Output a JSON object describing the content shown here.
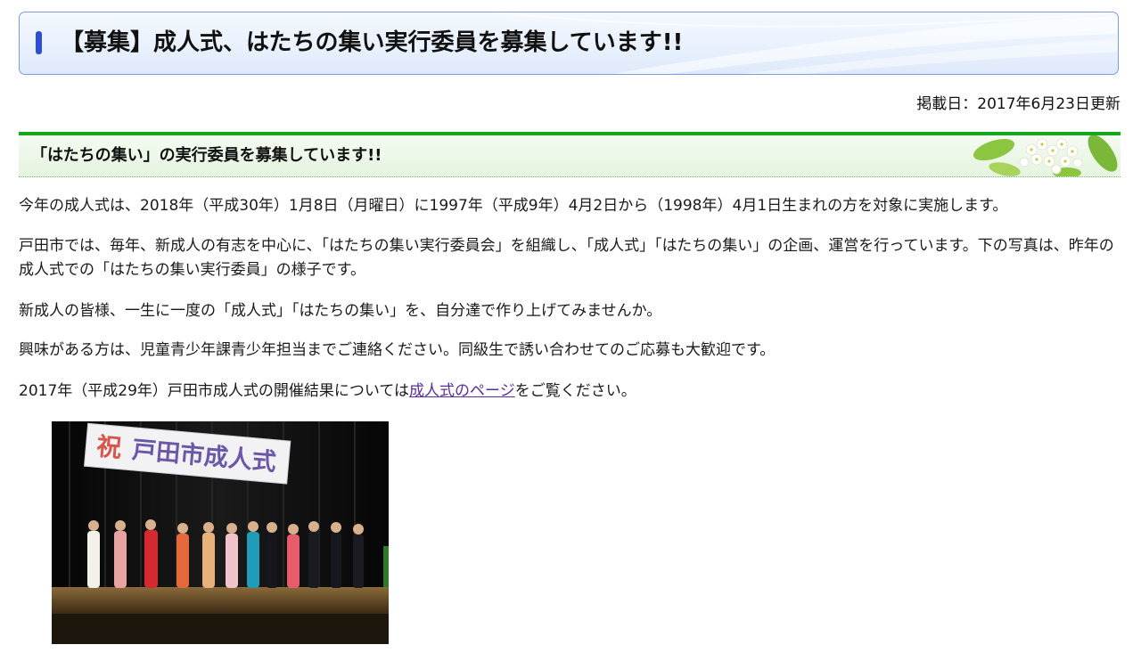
{
  "page": {
    "title": "【募集】成人式、はたちの集い実行委員を募集しています!!",
    "posted_date": "掲載日：2017年6月23日更新"
  },
  "section": {
    "heading": "「はたちの集い」の実行委員を募集しています!!"
  },
  "body": {
    "p1": "今年の成人式は、2018年（平成30年）1月8日（月曜日）に1997年（平成9年）4月2日から（1998年）4月1日生まれの方を対象に実施します。",
    "p2": "戸田市では、毎年、新成人の有志を中心に、「はたちの集い実行委員会」を組織し、「成人式」「はたちの集い」の企画、運営を行っています。下の写真は、昨年の成人式での「はたちの集い実行委員」の様子です。",
    "p3": "新成人の皆様、一生に一度の「成人式」「はたちの集い」を、自分達で作り上げてみませんか。",
    "p4": "興味がある方は、児童青少年課青少年担当までご連絡ください。同級生で誘い合わせてのご応募も大歓迎です。",
    "p5_before": "2017年（平成29年）戸田市成人式の開催結果については",
    "p5_link": "成人式のページ",
    "p5_after": "をご覧ください。"
  },
  "photo": {
    "banner_celebrate": "祝",
    "banner_text": "戸田市成人式"
  },
  "colors": {
    "title_accent": "#2c4fd3",
    "section_rule": "#15a81c",
    "link": "#5b2f98"
  }
}
